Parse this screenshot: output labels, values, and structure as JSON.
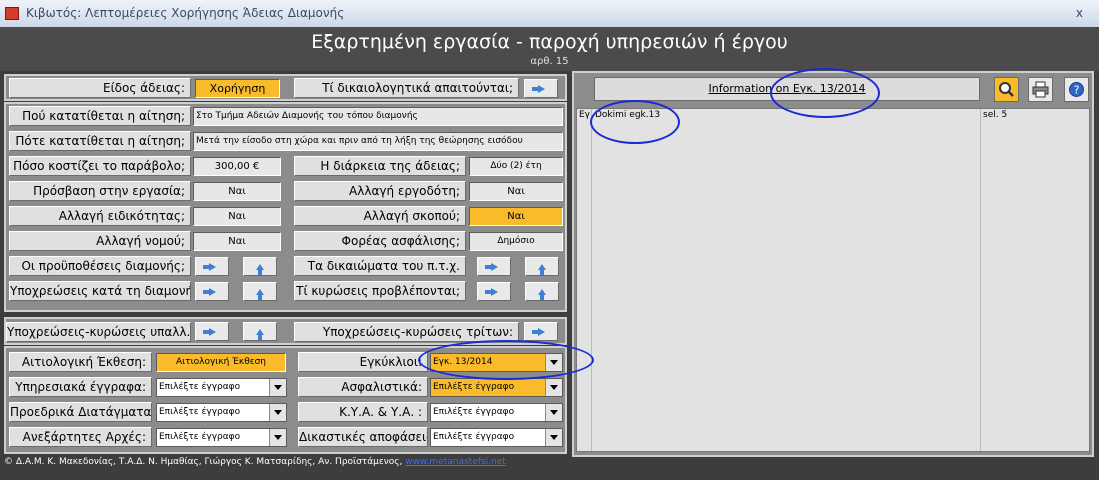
{
  "window": {
    "title": "Κιβωτός: Λεπτομέρειες Χορήγησης Άδειας Διαμονής",
    "close": "x"
  },
  "header": {
    "title": "Εξαρτημένη εργασία - παροχή υπηρεσιών ή έργου",
    "subtitle": "αρθ. 15"
  },
  "permit": {
    "type_label": "Είδος άδειας:",
    "type_value": "Χορήγηση",
    "docs_label": "Τί δικαιολογητικά απαιτούνται;"
  },
  "details": {
    "where_label": "Πού κατατίθεται η αίτηση;",
    "where_value": "Στο Τμήμα Αδειών Διαμονής του τόπου διαμονής",
    "when_label": "Πότε κατατίθεται η αίτηση;",
    "when_value": "Μετά την είσοδο στη χώρα και πριν από τη λήξη της θεώρησης εισόδου",
    "fee_label": "Πόσο κοστίζει το παράβολο;",
    "fee_value": "300,00 €",
    "duration_label": "Η διάρκεια της άδειας;",
    "duration_value": "Δύο (2) έτη",
    "access_label": "Πρόσβαση στην εργασία;",
    "access_value": "Ναι",
    "employer_label": "Αλλαγή εργοδότη;",
    "employer_value": "Ναι",
    "specialty_label": "Αλλαγή ειδικότητας;",
    "specialty_value": "Ναι",
    "purpose_label": "Αλλαγή σκοπού;",
    "purpose_value": "Ναι",
    "prefecture_label": "Αλλαγή νομού;",
    "prefecture_value": "Ναι",
    "insurance_label": "Φορέας ασφάλισης;",
    "insurance_value": "Δημόσιο",
    "conditions_label": "Οι προϋποθέσεις διαμονής;",
    "rights_label": "Τα δικαιώματα του π.τ.χ.",
    "obligations_label": "Υποχρεώσεις κατά τη διαμονή;",
    "sanctions_label": "Τί κυρώσεις προβλέπονται;"
  },
  "officials": {
    "employee_label": "Υποχρεώσεις-κυρώσεις υπαλλ.:",
    "third_label": "Υποχρεώσεις-κυρώσεις τρίτων:"
  },
  "docs": {
    "report_label": "Αιτιολογική Έκθεση:",
    "report_value": "Αιτιολογική Έκθεση",
    "circulars_label": "Εγκύκλιοι:",
    "circulars_value": "Εγκ. 13/2014",
    "service_label": "Υπηρεσιακά έγγραφα:",
    "service_value": "Επιλέξτε έγγραφο",
    "insurance_label": "Ασφαλιστικά:",
    "insurance_value": "Επιλέξτε έγγραφο",
    "decrees_label": "Προεδρικά Διατάγματα:",
    "decrees_value": "Επιλέξτε έγγραφο",
    "kya_label": "Κ.Υ.Α. & Υ.Α. :",
    "kya_value": "Επιλέξτε έγγραφο",
    "authorities_label": "Ανεξάρτητες Αρχές:",
    "authorities_value": "Επιλέξτε έγγραφο",
    "court_label": "Δικαστικές αποφάσεις:",
    "court_value": "Επιλέξτε έγγραφο"
  },
  "info": {
    "title": "Information on Εγκ. 13/2014",
    "row": {
      "c1": "Εγ",
      "c2": "Dokimi egk.13",
      "c3": "sel. 5"
    }
  },
  "footer": {
    "text": "© Δ.Α.Μ. Κ. Μακεδονίας, Τ.Α.Δ. Ν. Ημαθίας, Γιώργος Κ. Ματσαρίδης, Αν. Προϊστάμενος,",
    "link": "www.metanastefsi.net"
  },
  "colors": {
    "accent": "#f9bb2a",
    "arrow": "#3f7fd8",
    "annotation": "#1a2ad4"
  }
}
